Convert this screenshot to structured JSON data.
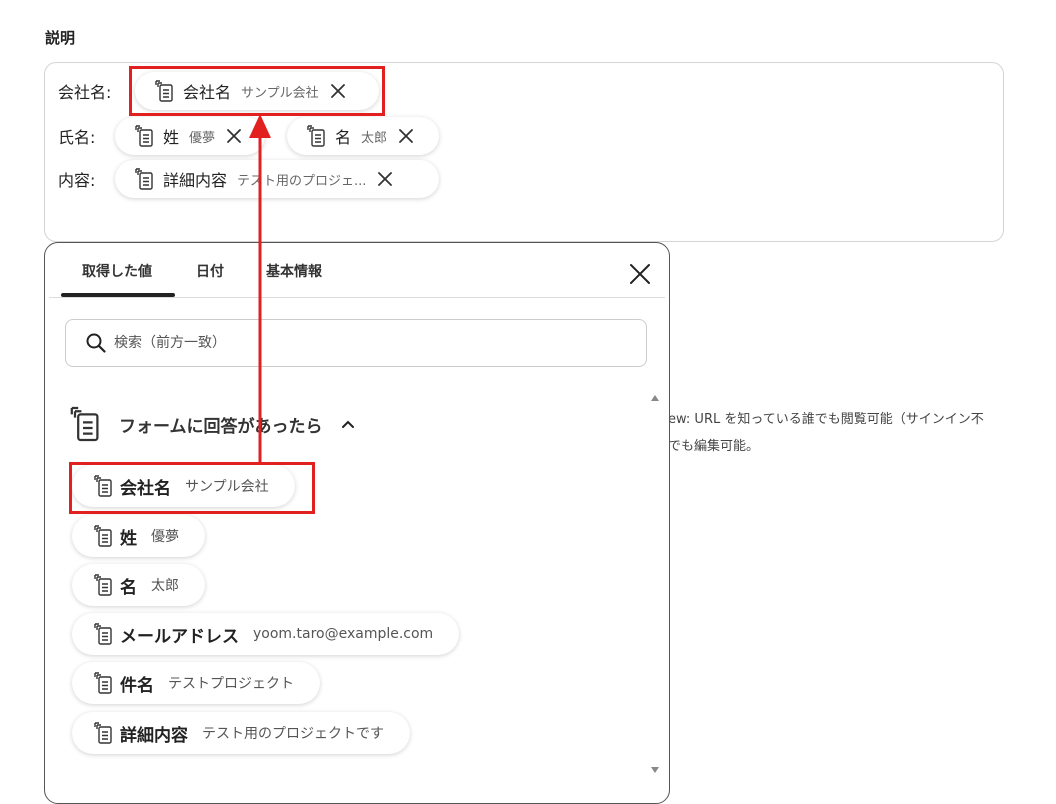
{
  "section": {
    "label": "説明"
  },
  "description": {
    "lines": [
      {
        "label": "会社名:",
        "pills": [
          {
            "name": "会社名",
            "value": "サンプル会社"
          }
        ]
      },
      {
        "label": "氏名:",
        "pills": [
          {
            "name": "姓",
            "value": "優夢"
          },
          {
            "name": "名",
            "value": "太郎"
          }
        ]
      },
      {
        "label": "内容:",
        "pills": [
          {
            "name": "詳細内容",
            "value": "テスト用のプロジェ..."
          }
        ]
      }
    ]
  },
  "right_text": {
    "line1": "ew: URL を知っている誰でも閲覧可能（サインイン不",
    "line2": "でも編集可能。"
  },
  "picker": {
    "tabs": [
      {
        "label": "取得した値",
        "active": true
      },
      {
        "label": "日付"
      },
      {
        "label": "基本情報"
      }
    ],
    "search_placeholder": "検索（前方一致）",
    "group_title": "フォームに回答があったら",
    "items": [
      {
        "name": "会社名",
        "value": "サンプル会社"
      },
      {
        "name": "姓",
        "value": "優夢"
      },
      {
        "name": "名",
        "value": "太郎"
      },
      {
        "name": "メールアドレス",
        "value": "yoom.taro@example.com"
      },
      {
        "name": "件名",
        "value": "テストプロジェクト"
      },
      {
        "name": "詳細内容",
        "value": "テスト用のプロジェクトです"
      }
    ]
  },
  "colors": {
    "highlight": "#e32020",
    "text": "#222222"
  },
  "icons": {
    "field": "form-field-icon",
    "remove": "close-icon",
    "search": "search-icon",
    "collapse": "chevron-up-icon"
  }
}
